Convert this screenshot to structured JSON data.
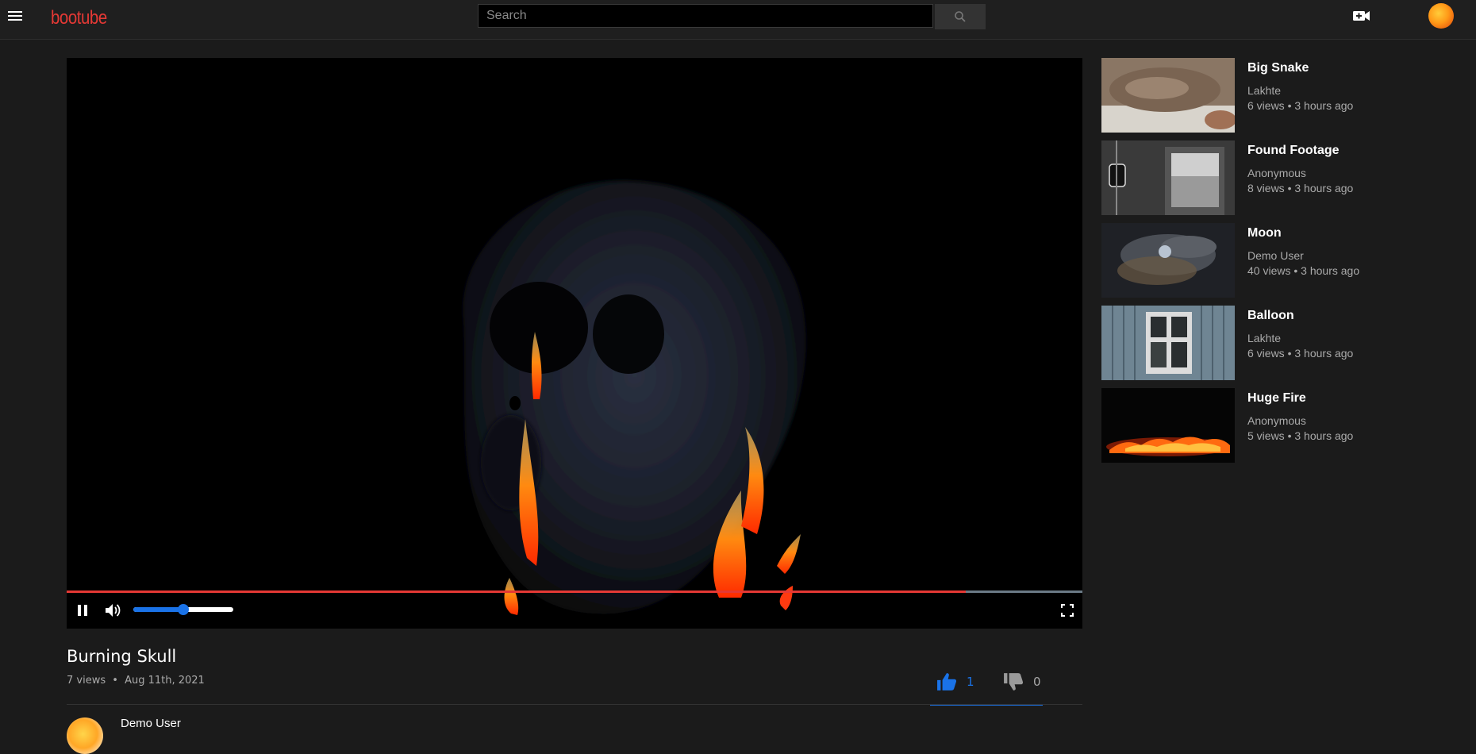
{
  "header": {
    "logo": "bootube",
    "search": {
      "placeholder": "Search",
      "value": ""
    },
    "icons": [
      "hamburger-menu-icon",
      "search-icon",
      "video-camera-plus-icon",
      "user-avatar"
    ]
  },
  "player": {
    "progress_fraction": 0.885,
    "volume_fraction": 0.5,
    "state": "playing",
    "icons": [
      "pause-icon",
      "volume-icon",
      "fullscreen-icon"
    ]
  },
  "video": {
    "title": "Burning Skull",
    "views": "7 views",
    "date": "Aug 11th, 2021",
    "likes": "1",
    "dislikes": "0",
    "owner": "Demo User"
  },
  "meta_separator": "•",
  "sidebar": {
    "items": [
      {
        "title": "Big Snake",
        "channel": "Lakhte",
        "views": "6 views",
        "time": "3 hours ago"
      },
      {
        "title": "Found Footage",
        "channel": "Anonymous",
        "views": "8 views",
        "time": "3 hours ago"
      },
      {
        "title": "Moon",
        "channel": "Demo User",
        "views": "40 views",
        "time": "3 hours ago"
      },
      {
        "title": "Balloon",
        "channel": "Lakhte",
        "views": "6 views",
        "time": "3 hours ago"
      },
      {
        "title": "Huge Fire",
        "channel": "Anonymous",
        "views": "5 views",
        "time": "3 hours ago"
      }
    ]
  },
  "colors": {
    "accent": "#1a73e8",
    "brand": "#e53935",
    "background": "#1b1b1b"
  }
}
